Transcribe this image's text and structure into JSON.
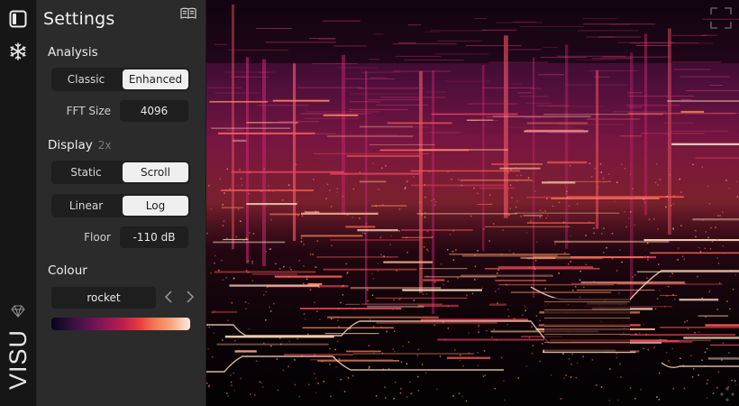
{
  "panel": {
    "title": "Settings",
    "analysis": {
      "heading": "Analysis",
      "mode_options": [
        "Classic",
        "Enhanced"
      ],
      "mode_selected": "Enhanced",
      "fft_label": "FFT Size",
      "fft_value": "4096"
    },
    "display": {
      "heading": "Display",
      "hint": "2x",
      "motion_options": [
        "Static",
        "Scroll"
      ],
      "motion_selected": "Scroll",
      "scale_options": [
        "Linear",
        "Log"
      ],
      "scale_selected": "Log",
      "floor_label": "Floor",
      "floor_value": "-110 dB"
    },
    "colour": {
      "heading": "Colour",
      "colormap": "rocket"
    }
  },
  "brand": "VISU",
  "icons": {
    "sidebar_toggle": "sidebar-toggle-icon",
    "freeze": "snowflake-icon",
    "docs": "book-icon",
    "gem": "gem-icon",
    "fullscreen": "fullscreen-icon",
    "resize": "resize-grip-icon"
  },
  "colors": {
    "panel_bg": "#2b2b2b",
    "rail_bg": "#161616",
    "selected_bg": "#efefef",
    "spectrogram_bg": "#050204"
  }
}
